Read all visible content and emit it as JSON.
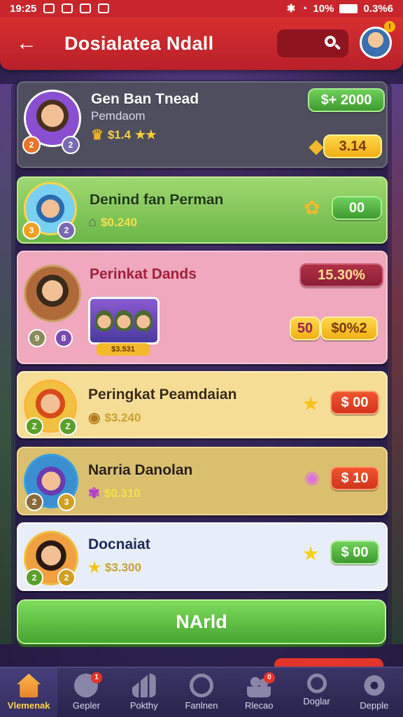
{
  "status_bar": {
    "time": "19:25",
    "battery": "10%",
    "right_text": "0.3%6"
  },
  "header": {
    "title": "Dosialatea Ndall",
    "back_symbol": "←"
  },
  "colors": {
    "header_red": "#c8262c",
    "card_green": "#6bb748",
    "card_pink": "#efa8bd",
    "card_yellow": "#f6dd96",
    "card_gold": "#d9bf6e",
    "card_light": "#e8eef9"
  },
  "leaderboard": [
    {
      "name": "Gen Ban Tnead",
      "subtitle": "Pemdaom",
      "score": "$1.4",
      "score_icon": "crown-icon",
      "value_pill": "$+ 2000",
      "secondary_pill": "3.14",
      "badge_left": "2",
      "badge_right": "2"
    },
    {
      "name": "Denind fan Perman",
      "score": "$0.240",
      "score_icon": "house-icon",
      "gem_icon": "puzzle-gem-icon",
      "value_pill": "00",
      "badge_left": "3",
      "badge_right": "2"
    },
    {
      "name": "Perinkat Dands",
      "score_pill": "15.30%",
      "value_pill_a": "50",
      "value_pill_b": "$0%2",
      "group_label": "$3.531",
      "badge_left": "9",
      "badge_right": "8"
    },
    {
      "name": "Peringkat Peamdaian",
      "score": "$3.240",
      "score_icon": "coin-icon",
      "gem_icon": "star-gem-icon",
      "value_pill": "$ 00",
      "badge_left": "Z",
      "badge_right": "Z"
    },
    {
      "name": "Narria Danolan",
      "score": "$0.310",
      "score_icon": "flower-icon",
      "gem_icon": "flower-gem-icon",
      "value_pill": "$ 10",
      "badge_left": "2",
      "badge_right": "3"
    },
    {
      "name": "Docnaiat",
      "score": "$3.300",
      "score_icon": "star-icon",
      "gem_icon": "star-gem-icon",
      "value_pill": "$ 00",
      "badge_left": "2",
      "badge_right": "2"
    }
  ],
  "primary_button": {
    "label": "NArld"
  },
  "bottom_nav": [
    {
      "label": "Vlemenak",
      "icon": "home-icon",
      "active": true
    },
    {
      "label": "Gepler",
      "icon": "chat-icon",
      "badge": "1"
    },
    {
      "label": "Pokthy",
      "icon": "chart-icon"
    },
    {
      "label": "Fanlnen",
      "icon": "timer-icon"
    },
    {
      "label": "Rlecao",
      "icon": "users-icon",
      "badge": "0"
    },
    {
      "label": "Doglar",
      "icon": "search-icon"
    },
    {
      "label": "Depple",
      "icon": "gear-icon"
    }
  ]
}
